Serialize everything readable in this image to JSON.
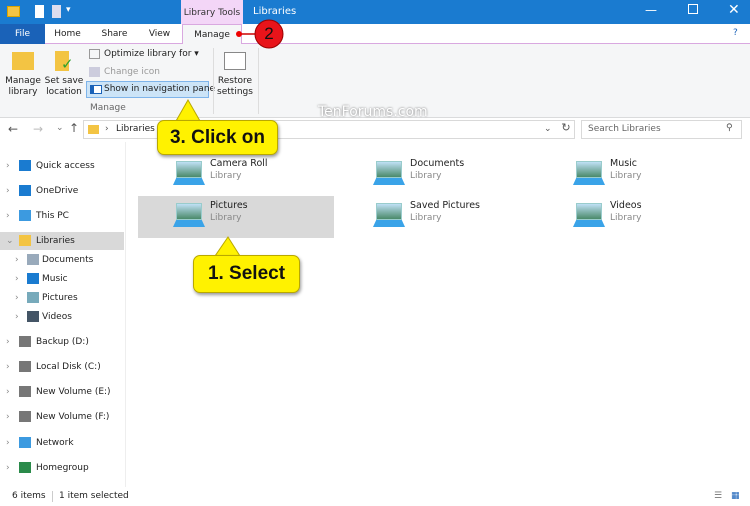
{
  "window": {
    "title": "Libraries",
    "contextual_tab": "Library Tools"
  },
  "tabs": [
    "File",
    "Home",
    "Share",
    "View",
    "Manage"
  ],
  "ribbon": {
    "manage_library": "Manage\nlibrary",
    "set_save_location": "Set save\nlocation",
    "optimize": "Optimize library for",
    "change_icon": "Change icon",
    "show_nav": "Show in navigation pane",
    "group_label": "Manage",
    "restore": "Restore\nsettings"
  },
  "address": {
    "path": "Libraries",
    "search_placeholder": "Search Libraries"
  },
  "watermark": "TenForums.com",
  "nav": [
    {
      "label": "Quick access",
      "icon": "star-icon"
    },
    {
      "label": "OneDrive",
      "icon": "cloud-icon"
    },
    {
      "label": "This PC",
      "icon": "computer-icon"
    },
    {
      "label": "Libraries",
      "icon": "library-icon",
      "selected": true
    },
    {
      "label": "Documents",
      "icon": "documents-icon"
    },
    {
      "label": "Music",
      "icon": "music-icon"
    },
    {
      "label": "Pictures",
      "icon": "pictures-icon"
    },
    {
      "label": "Videos",
      "icon": "videos-icon"
    },
    {
      "label": "Backup (D:)",
      "icon": "drive-icon"
    },
    {
      "label": "Local Disk (C:)",
      "icon": "drive-icon"
    },
    {
      "label": "New Volume (E:)",
      "icon": "drive-icon"
    },
    {
      "label": "New Volume (F:)",
      "icon": "drive-icon"
    },
    {
      "label": "Network",
      "icon": "network-icon"
    },
    {
      "label": "Homegroup",
      "icon": "homegroup-icon"
    }
  ],
  "libraries": [
    {
      "name": "Camera Roll",
      "type": "Library"
    },
    {
      "name": "Documents",
      "type": "Library"
    },
    {
      "name": "Music",
      "type": "Library"
    },
    {
      "name": "Pictures",
      "type": "Library",
      "selected": true
    },
    {
      "name": "Saved Pictures",
      "type": "Library"
    },
    {
      "name": "Videos",
      "type": "Library"
    }
  ],
  "callouts": {
    "step1": "1. Select",
    "step2": "2",
    "step3": "3. Click on"
  },
  "status": {
    "count": "6 items",
    "selected": "1 item selected"
  },
  "colors": {
    "accent": "#1a7bd0",
    "callout": "#fff200",
    "selection": "#d9d9d9"
  }
}
